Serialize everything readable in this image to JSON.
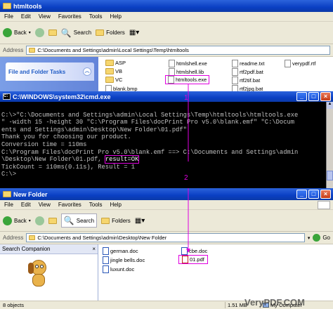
{
  "top_window": {
    "title": "htmltools",
    "menu": [
      "File",
      "Edit",
      "View",
      "Favorites",
      "Tools",
      "Help"
    ],
    "back": "Back",
    "search": "Search",
    "folders": "Folders",
    "address_label": "Address",
    "address": "C:\\Documents and Settings\\admin\\Local Settings\\Temp\\htmltools",
    "task_panel": "File and Folder Tasks",
    "files": {
      "asp": "ASP",
      "vb": "VB",
      "vc": "VC",
      "blank": "blank.bmp",
      "htmlshell_exe": "htmlshell.exe",
      "htmlshell_lib": "htmlshell.lib",
      "htmltools_exe": "htmltools.exe",
      "readme": "readme.txt",
      "rtf2pdf": "rtf2pdf.bat",
      "rtf2tif": "rtf2tif.bat",
      "rtf2jpg": "rtf2jpg.bat",
      "verypdf": "verypdf.rtf"
    }
  },
  "cmd_window": {
    "title": "C:\\WINDOWS\\system32\\cmd.exe",
    "lines": [
      "C:\\>\"C:\\Documents and Settings\\admin\\Local Settings\\Temp\\htmltools\\htmltools.exe",
      "\" -width 15 -height 30 \"C:\\Program Files\\docPrint Pro v5.0\\blank.emf\" \"C:\\Docum",
      "ents and Settings\\admin\\Desktop\\New Folder\\01.pdf\"",
      "Thank you for choosing our product.",
      "Conversion time = 110ms",
      "C:\\Program Files\\docPrint Pro v5.0\\blank.emf ==> C:\\Documents and Settings\\admin",
      "\\Desktop\\New Folder\\01.pdf, ",
      "result=OK",
      "TickCount = 110ms(0.11s), Result = 1",
      "",
      "C:\\>"
    ]
  },
  "bottom_window": {
    "title": "New Folder",
    "menu": [
      "File",
      "Edit",
      "View",
      "Favorites",
      "Tools",
      "Help"
    ],
    "back": "Back",
    "search": "Search",
    "folders": "Folders",
    "address_label": "Address",
    "address": "C:\\Documents and Settings\\admin\\Desktop\\New Folder",
    "go": "Go",
    "search_companion": "Search Companion",
    "files": {
      "german": "german.doc",
      "jingle": "jingle bells.doc",
      "luxunt": "luxunt.doc",
      "cbe": "cbe.doc",
      "pdf01": "01.pdf"
    },
    "status_objects": "8 objects",
    "status_size": "1.51 MB",
    "status_location": "My Computer"
  },
  "annotations": {
    "n1": "1",
    "n2": "2"
  },
  "watermark": "VeryPDF.COM",
  "colors": {
    "titlebar": "#0a3fc3",
    "highlight": "#e000e0",
    "console_bg": "#000000"
  }
}
